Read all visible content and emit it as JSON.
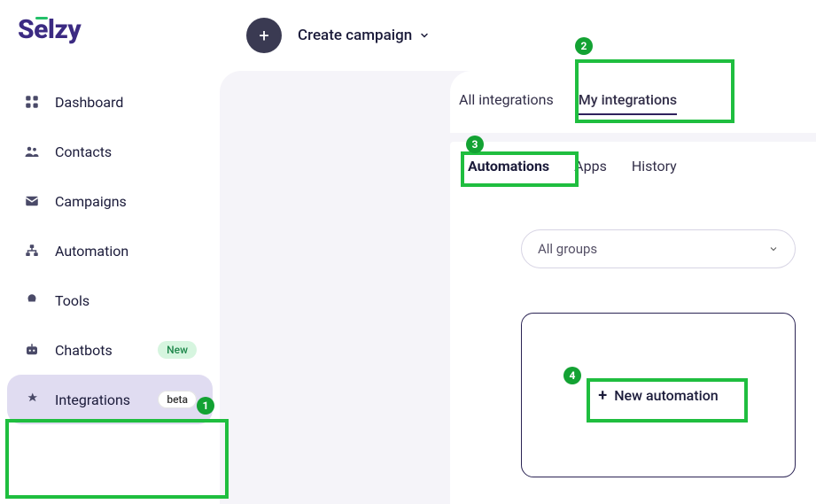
{
  "brand": "Selzy",
  "topbar": {
    "create_label": "Create campaign"
  },
  "sidebar": {
    "items": [
      {
        "label": "Dashboard",
        "icon": "dashboard-icon"
      },
      {
        "label": "Contacts",
        "icon": "contacts-icon"
      },
      {
        "label": "Campaigns",
        "icon": "campaigns-icon"
      },
      {
        "label": "Automation",
        "icon": "automation-icon"
      },
      {
        "label": "Tools",
        "icon": "tools-icon"
      },
      {
        "label": "Chatbots",
        "icon": "chatbots-icon",
        "badge": "New"
      },
      {
        "label": "Integrations",
        "icon": "integrations-icon",
        "badge": "beta"
      }
    ]
  },
  "tabs_top": {
    "all": "All integrations",
    "my": "My integrations"
  },
  "sub_tabs": {
    "automations": "Automations",
    "apps": "Apps",
    "history": "History"
  },
  "groups_select": {
    "label": "All groups"
  },
  "new_automation_label": "New automation",
  "annotations": {
    "1": "1",
    "2": "2",
    "3": "3",
    "4": "4"
  }
}
